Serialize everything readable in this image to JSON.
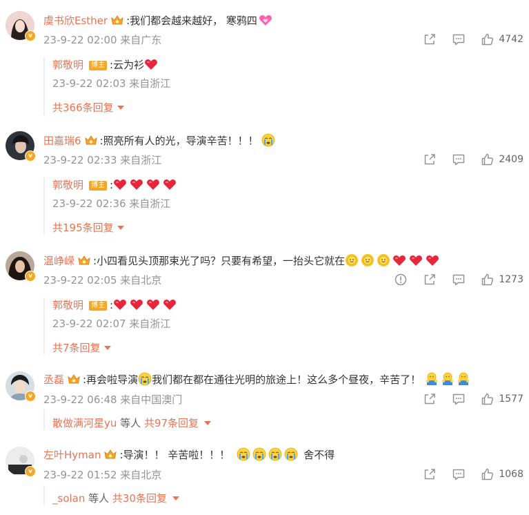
{
  "comments": [
    {
      "username": "虞书欣Esther",
      "text": ":我们都会越来越好， 寒鸦四",
      "meta": "23-9-22 02:00 来自广东",
      "likes": "4742",
      "avatar_color": "#e8c8c4",
      "reply": {
        "username": "郭敬明",
        "badge": "博主",
        "text": ":云为衫",
        "meta": "23-9-22 02:03 来自浙江"
      },
      "more": "共366条回复"
    },
    {
      "username": "田嘉瑞6",
      "text": ":照亮所有人的光，导演辛苦！！！",
      "meta": "23-9-22 02:33 来自浙江",
      "likes": "2409",
      "avatar_color": "#3a3f46",
      "reply": {
        "username": "郭敬明",
        "badge": "博主",
        "text": ":",
        "meta": "23-9-22 02:36 来自浙江"
      },
      "more": "共195条回复"
    },
    {
      "username": "温峥嵘",
      "text": ":小四看见头顶那束光了吗？只要有希望，一抬头它就在",
      "meta": "23-9-22 02:05 来自北京",
      "likes": "1273",
      "avatar_color": "#5a3a30",
      "reply": {
        "username": "郭敬明",
        "badge": "博主",
        "text": ":",
        "meta": "23-9-22 02:07 来自浙江"
      },
      "more": "共7条回复"
    },
    {
      "username": "丞磊",
      "text_a": ":再会啦导演",
      "text_b": "我们都在都在通往光明的旅途上！这么多个昼夜，辛苦了！",
      "meta": "23-9-22 06:48 来自中国澳门",
      "likes": "1577",
      "avatar_color": "#cfd6dc",
      "more_user": "散做满河星yu",
      "more_mid": " 等人 ",
      "more": "共97条回复"
    },
    {
      "username": "左叶Hyman",
      "text_a": ":导演！！ 辛苦啦！！！",
      "text_b": "舍不得",
      "meta": "23-9-22 01:52 来自北京",
      "likes": "1068",
      "avatar_color": "#e9e9e9",
      "more_user": "_solan",
      "more_mid": " 等人 ",
      "more": "共30条回复"
    }
  ],
  "colors": {
    "link": "#eb7350",
    "meta": "#939393",
    "badge": "#f5a623"
  },
  "icons": [
    "share-icon",
    "comment-icon",
    "like-icon",
    "report-icon",
    "crown-icon",
    "heart-emoji",
    "sun-emoji",
    "cry-emoji",
    "hug-emoji"
  ]
}
